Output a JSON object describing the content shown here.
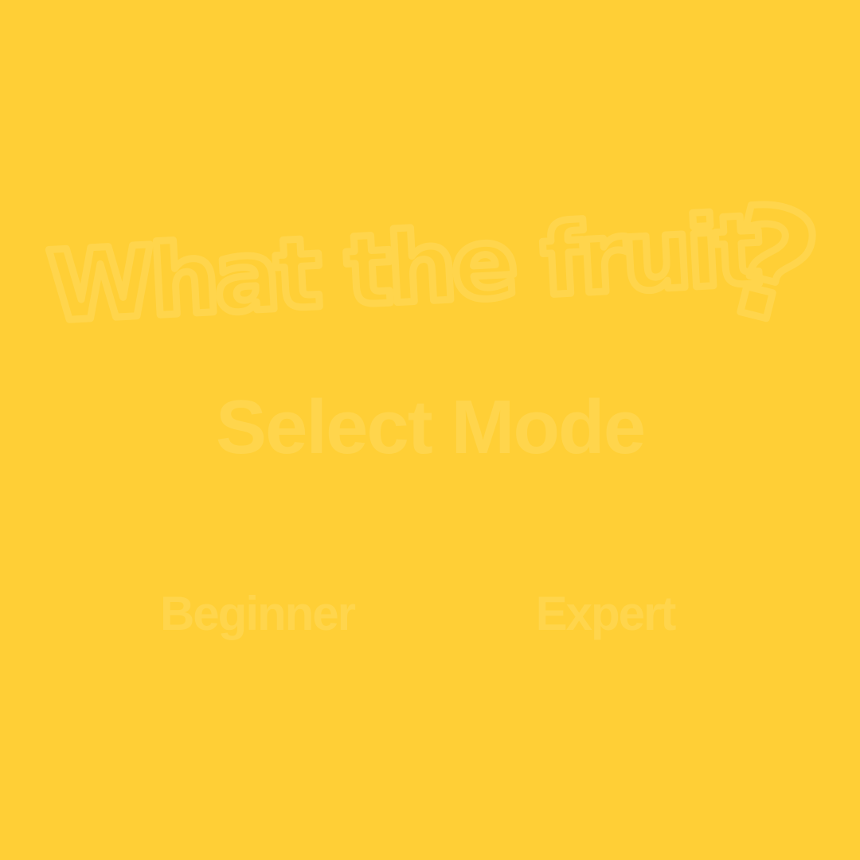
{
  "game": {
    "title": "What the fruit",
    "title_mark": "?",
    "heading": "Select Mode"
  },
  "modes": {
    "beginner_label": "Beginner",
    "expert_label": "Expert"
  },
  "colors": {
    "background": "#FFCF36",
    "text_faint": "#FFD54C"
  }
}
